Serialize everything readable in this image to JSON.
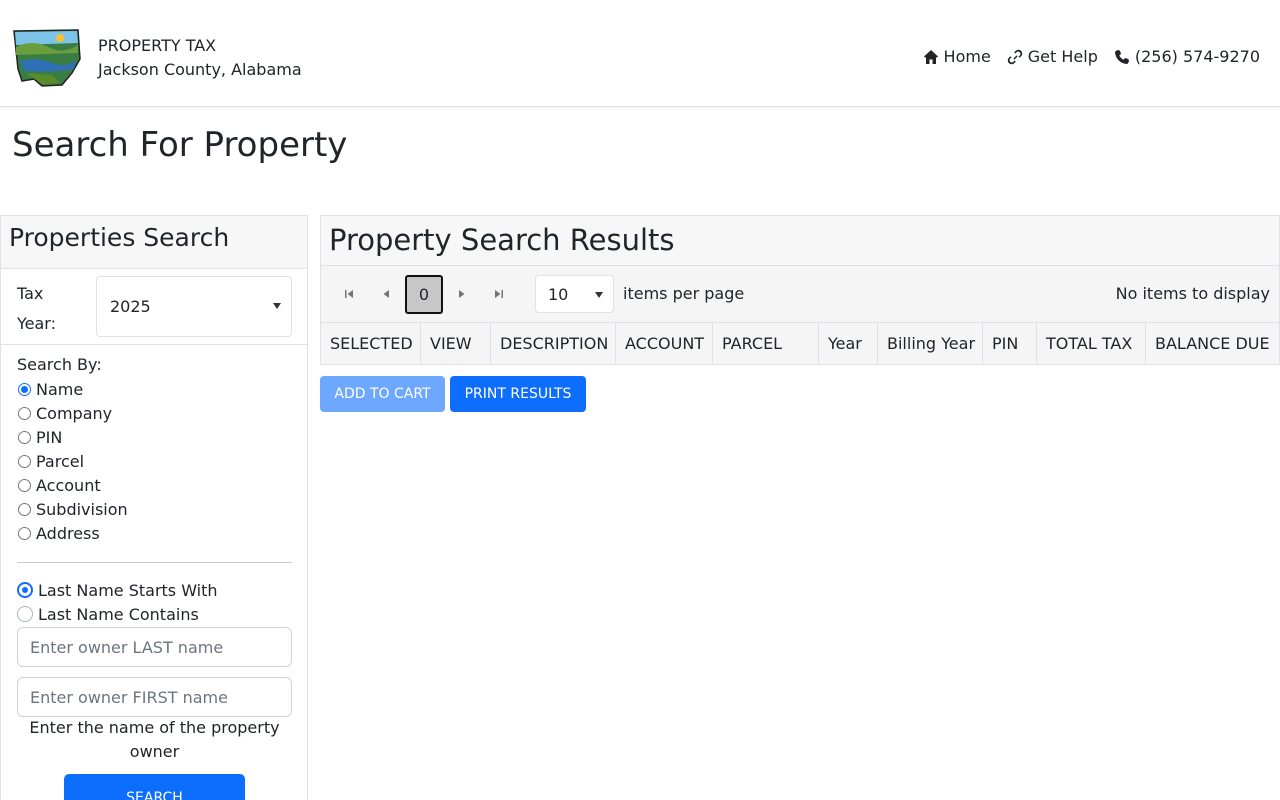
{
  "header": {
    "brand_title": "PROPERTY TAX",
    "brand_subtitle": "Jackson County, Alabama",
    "nav": [
      {
        "label": "Home",
        "icon": "home-icon"
      },
      {
        "label": "Get Help",
        "icon": "link-icon"
      },
      {
        "label": "(256) 574-9270",
        "icon": "phone-icon"
      }
    ]
  },
  "page_title": "Search For Property",
  "search_panel": {
    "title": "Properties Search",
    "tax_year_label": "Tax Year:",
    "tax_year_value": "2025",
    "search_by_label": "Search By:",
    "search_by_options": [
      "Name",
      "Company",
      "PIN",
      "Parcel",
      "Account",
      "Subdivision",
      "Address"
    ],
    "search_by_selected": "Name",
    "name_modes": [
      "Last Name Starts With",
      "Last Name Contains"
    ],
    "name_mode_selected": "Last Name Starts With",
    "last_name_placeholder": "Enter owner LAST name",
    "first_name_placeholder": "Enter owner FIRST name",
    "helper_text": "Enter the name of the property owner",
    "search_button": "SEARCH"
  },
  "results": {
    "title": "Property Search Results",
    "current_page": "0",
    "items_per_page": "10",
    "items_per_page_label": "items per page",
    "status": "No items to display",
    "columns": [
      "SELECTED",
      "VIEW",
      "DESCRIPTION",
      "ACCOUNT",
      "PARCEL",
      "Year",
      "Billing Year",
      "PIN",
      "TOTAL TAX",
      "BALANCE DUE"
    ]
  },
  "actions": {
    "add_to_cart": "ADD TO CART",
    "print_results": "PRINT RESULTS"
  },
  "colors": {
    "primary": "#0d6efd",
    "primary_disabled": "#6ea8fe"
  }
}
